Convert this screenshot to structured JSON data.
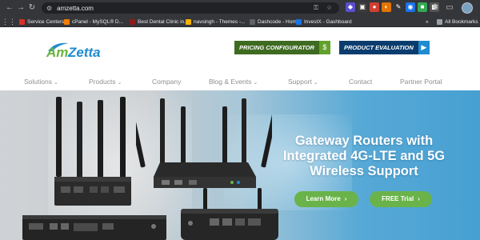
{
  "browser": {
    "url": "amzetta.com",
    "bookmarks": [
      {
        "label": "Service Centers",
        "color": "#d93025"
      },
      {
        "label": "cPanel - MySQL® D...",
        "color": "#f57c00"
      },
      {
        "label": "Best Dental Clinic in...",
        "color": "#8e1b1b"
      },
      {
        "label": "navsingh - Themes -...",
        "color": "#f4b400"
      },
      {
        "label": "Dashcode - Home",
        "color": "#5f6368"
      },
      {
        "label": "InvestX - Gashboard",
        "color": "#1a73e8"
      }
    ],
    "all_bookmarks": "All Bookmarks"
  },
  "site": {
    "logo_text": "AmZetta",
    "pricing_label": "PRICING CONFIGURATOR",
    "pricing_icon": "$",
    "product_label": "PRODUCT EVALUATION",
    "nav": [
      {
        "label": "Solutions",
        "chevron": true
      },
      {
        "label": "Products",
        "chevron": true
      },
      {
        "label": "Company",
        "chevron": false
      },
      {
        "label": "Blog & Events",
        "chevron": true
      },
      {
        "label": "Support",
        "chevron": true
      },
      {
        "label": "Contact",
        "chevron": false
      },
      {
        "label": "Partner Portal",
        "chevron": false
      }
    ]
  },
  "hero": {
    "title_line1": "Gateway Routers with",
    "title_line2": "Integrated 4G-LTE and 5G",
    "title_line3": "Wireless Support",
    "learn_more": "Learn More",
    "free_trial": "FREE Trial"
  },
  "colors": {
    "pricing_green": "#62a12c",
    "product_blue": "#0a3d6e",
    "hero_button": "#6ab34a",
    "logo_green": "#6ab23e",
    "logo_blue": "#1f8bd0"
  }
}
